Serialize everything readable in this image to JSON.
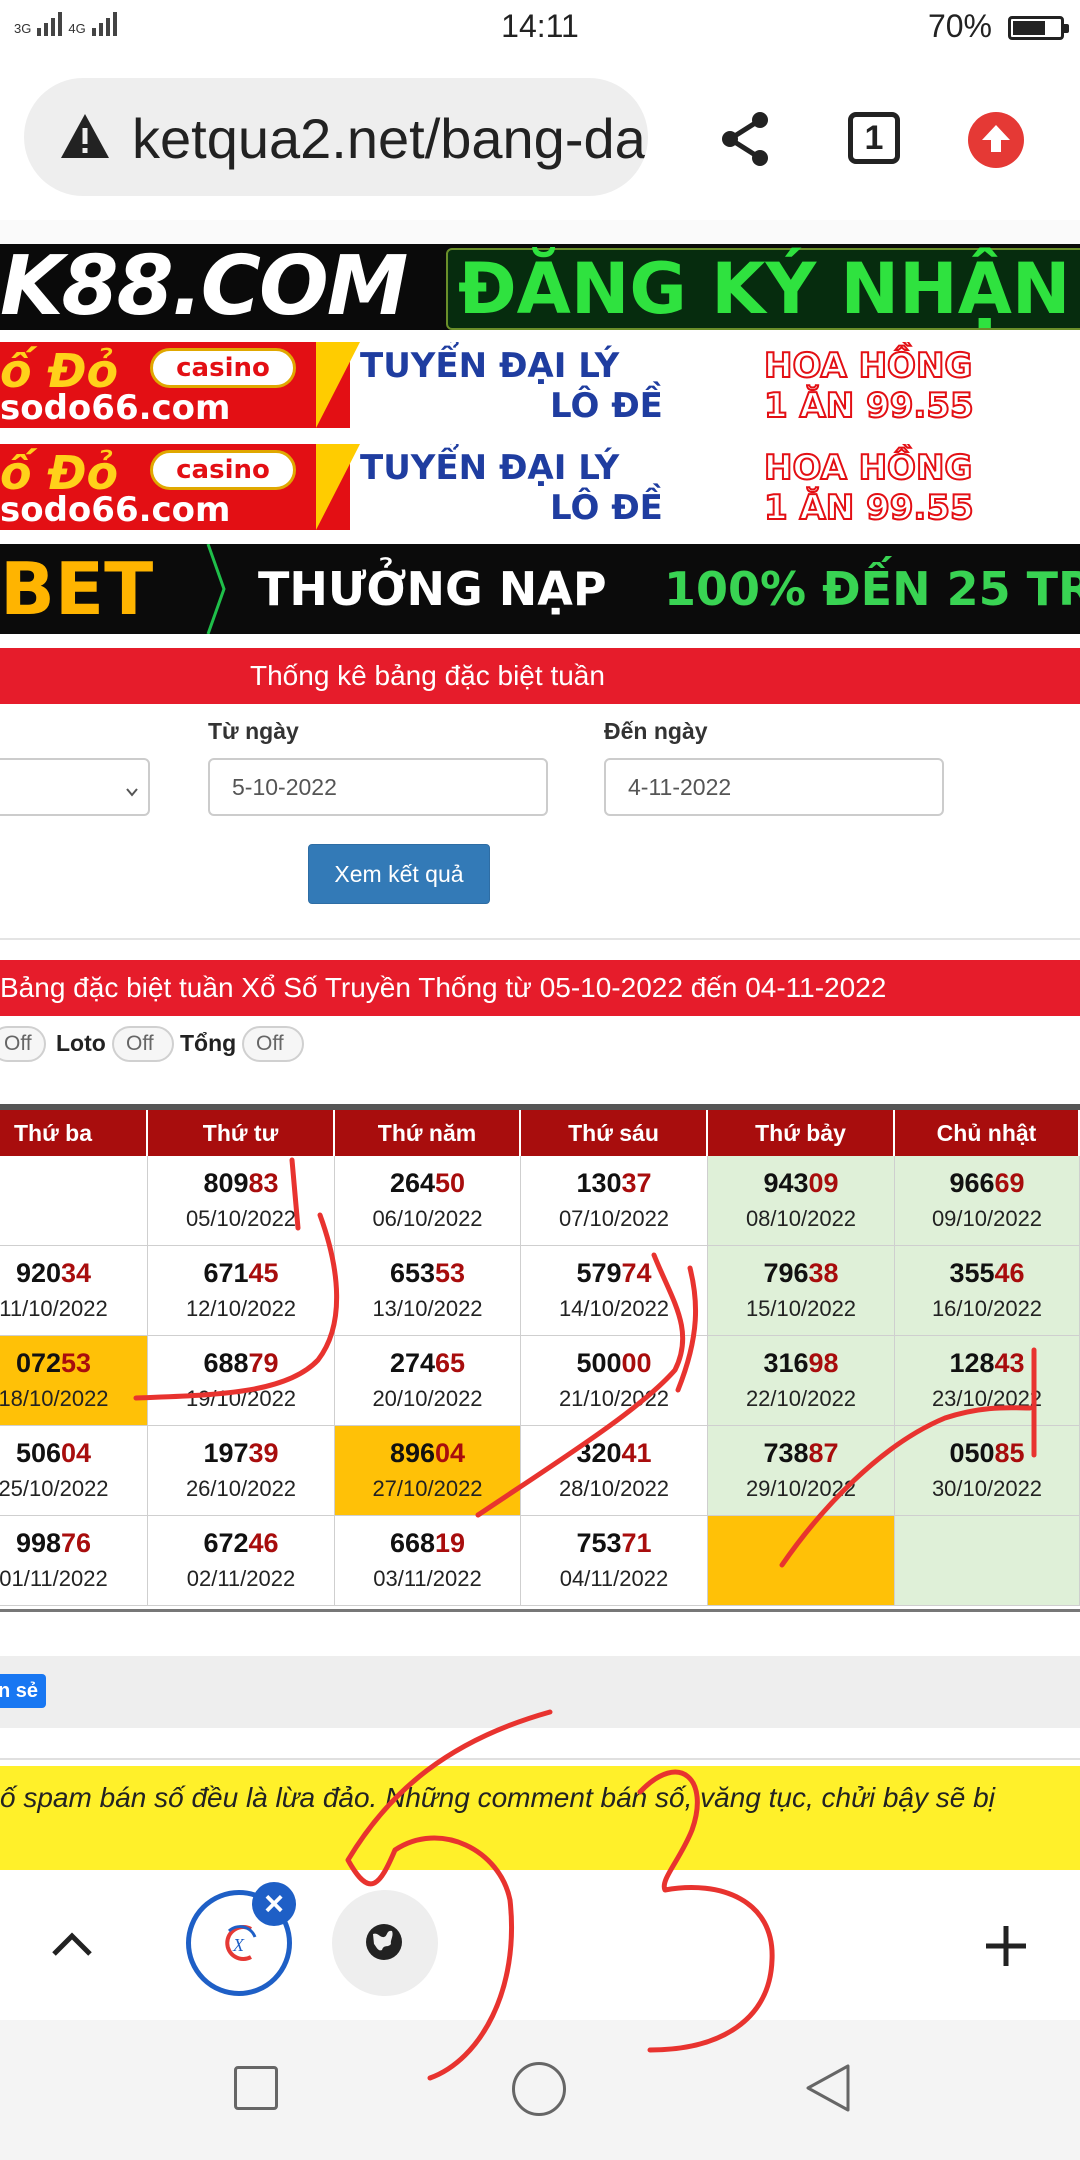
{
  "status_bar": {
    "network_1": "3G",
    "network_2": "4G",
    "time": "14:11",
    "battery_percent": "70%",
    "battery_level": 0.7
  },
  "browser": {
    "url": "ketqua2.net/bang-da",
    "tab_count": "1"
  },
  "banners": {
    "k88_left": "K88.COM",
    "k88_right": "ĐĂNG KÝ NHẬN",
    "sodo_brand": "ố Đỏ",
    "sodo_casino": "casino",
    "sodo_url": "sodo66.com",
    "sodo_recruit": "TUYỂN ĐẠI LÝ",
    "sodo_lode": "LÔ ĐỀ",
    "sodo_hoahong": "HOA HỒNG",
    "sodo_rate": "1 ĂN 99.55",
    "bet_left": "BET",
    "bet_text1": "THƯỞNG NẠP",
    "bet_text2": "100% ĐẾN 25 TR"
  },
  "filter": {
    "header": "Thống kê bảng đặc biệt tuần",
    "from_label": "Từ ngày",
    "to_label": "Đến ngày",
    "from_value": "5-10-2022",
    "to_value": "4-11-2022",
    "submit_label": "Xem kết quả"
  },
  "table": {
    "title": "Bảng đặc biệt tuần Xổ Số Truyền Thống từ 05-10-2022 đến 04-11-2022",
    "toggles": {
      "first_state": "Off",
      "loto_label": "Loto",
      "loto_state": "Off",
      "tong_label": "Tổng",
      "tong_state": "Off"
    },
    "headers": [
      "Thứ ba",
      "Thứ tư",
      "Thứ năm",
      "Thứ sáu",
      "Thứ bảy",
      "Chủ nhật"
    ],
    "rows": [
      [
        {
          "head": "",
          "tail": "",
          "date": "",
          "weekend": false,
          "hl": false
        },
        {
          "head": "809",
          "tail": "83",
          "date": "05/10/2022",
          "weekend": false,
          "hl": false
        },
        {
          "head": "264",
          "tail": "50",
          "date": "06/10/2022",
          "weekend": false,
          "hl": false
        },
        {
          "head": "130",
          "tail": "37",
          "date": "07/10/2022",
          "weekend": false,
          "hl": false
        },
        {
          "head": "943",
          "tail": "09",
          "date": "08/10/2022",
          "weekend": true,
          "hl": false
        },
        {
          "head": "966",
          "tail": "69",
          "date": "09/10/2022",
          "weekend": true,
          "hl": false
        }
      ],
      [
        {
          "head": "920",
          "tail": "34",
          "date": "11/10/2022",
          "weekend": false,
          "hl": false
        },
        {
          "head": "671",
          "tail": "45",
          "date": "12/10/2022",
          "weekend": false,
          "hl": false
        },
        {
          "head": "653",
          "tail": "53",
          "date": "13/10/2022",
          "weekend": false,
          "hl": false
        },
        {
          "head": "579",
          "tail": "74",
          "date": "14/10/2022",
          "weekend": false,
          "hl": false
        },
        {
          "head": "796",
          "tail": "38",
          "date": "15/10/2022",
          "weekend": true,
          "hl": false
        },
        {
          "head": "355",
          "tail": "46",
          "date": "16/10/2022",
          "weekend": true,
          "hl": false
        }
      ],
      [
        {
          "head": "072",
          "tail": "53",
          "date": "18/10/2022",
          "weekend": false,
          "hl": true
        },
        {
          "head": "688",
          "tail": "79",
          "date": "19/10/2022",
          "weekend": false,
          "hl": false
        },
        {
          "head": "274",
          "tail": "65",
          "date": "20/10/2022",
          "weekend": false,
          "hl": false
        },
        {
          "head": "500",
          "tail": "00",
          "date": "21/10/2022",
          "weekend": false,
          "hl": false
        },
        {
          "head": "316",
          "tail": "98",
          "date": "22/10/2022",
          "weekend": true,
          "hl": false
        },
        {
          "head": "128",
          "tail": "43",
          "date": "23/10/2022",
          "weekend": true,
          "hl": false
        }
      ],
      [
        {
          "head": "506",
          "tail": "04",
          "date": "25/10/2022",
          "weekend": false,
          "hl": false
        },
        {
          "head": "197",
          "tail": "39",
          "date": "26/10/2022",
          "weekend": false,
          "hl": false
        },
        {
          "head": "896",
          "tail": "04",
          "date": "27/10/2022",
          "weekend": false,
          "hl": true
        },
        {
          "head": "320",
          "tail": "41",
          "date": "28/10/2022",
          "weekend": false,
          "hl": false
        },
        {
          "head": "738",
          "tail": "87",
          "date": "29/10/2022",
          "weekend": true,
          "hl": false
        },
        {
          "head": "050",
          "tail": "85",
          "date": "30/10/2022",
          "weekend": true,
          "hl": false
        }
      ],
      [
        {
          "head": "998",
          "tail": "76",
          "date": "01/11/2022",
          "weekend": false,
          "hl": false
        },
        {
          "head": "672",
          "tail": "46",
          "date": "02/11/2022",
          "weekend": false,
          "hl": false
        },
        {
          "head": "668",
          "tail": "19",
          "date": "03/11/2022",
          "weekend": false,
          "hl": false
        },
        {
          "head": "753",
          "tail": "71",
          "date": "04/11/2022",
          "weekend": false,
          "hl": false
        },
        {
          "head": "",
          "tail": "",
          "date": "",
          "weekend": true,
          "hl": true
        },
        {
          "head": "",
          "tail": "",
          "date": "",
          "weekend": true,
          "hl": false
        }
      ]
    ]
  },
  "lower": {
    "share_label": "n sẻ",
    "warning_text": "ố spam bán số đều là lừa đảo. Những comment bán số, văng tục, chửi bậy sẽ bị"
  },
  "bottom_bar": {
    "tab_logo_text": "X",
    "close_label": "×"
  },
  "annotations": {
    "digit_left": "5",
    "digit_right": "3"
  },
  "colors": {
    "accent_red": "#e61c2b",
    "header_dark_red": "#a80d0d",
    "weekend_green": "#dff0d8",
    "highlight_yellow": "#ffc107",
    "button_blue": "#337ab7",
    "scribble_red": "#e8332f"
  }
}
